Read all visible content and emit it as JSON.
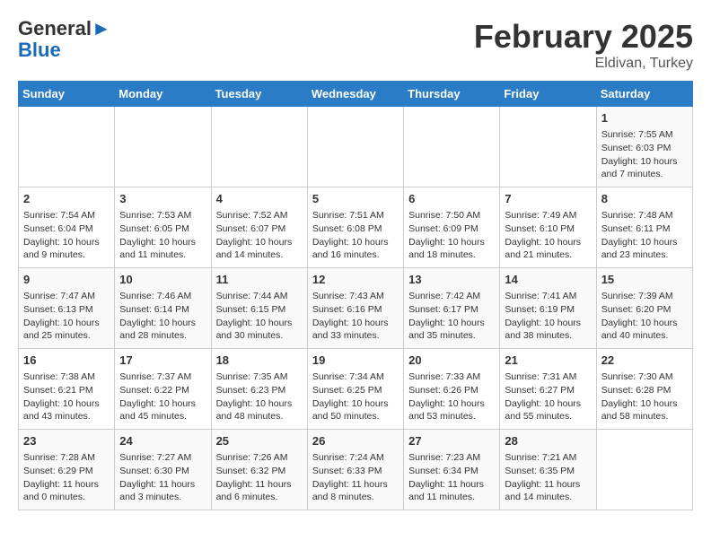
{
  "header": {
    "logo_line1": "General",
    "logo_line2": "Blue",
    "main_title": "February 2025",
    "subtitle": "Eldivan, Turkey"
  },
  "days_of_week": [
    "Sunday",
    "Monday",
    "Tuesday",
    "Wednesday",
    "Thursday",
    "Friday",
    "Saturday"
  ],
  "weeks": [
    [
      {
        "num": "",
        "info": ""
      },
      {
        "num": "",
        "info": ""
      },
      {
        "num": "",
        "info": ""
      },
      {
        "num": "",
        "info": ""
      },
      {
        "num": "",
        "info": ""
      },
      {
        "num": "",
        "info": ""
      },
      {
        "num": "1",
        "info": "Sunrise: 7:55 AM\nSunset: 6:03 PM\nDaylight: 10 hours and 7 minutes."
      }
    ],
    [
      {
        "num": "2",
        "info": "Sunrise: 7:54 AM\nSunset: 6:04 PM\nDaylight: 10 hours and 9 minutes."
      },
      {
        "num": "3",
        "info": "Sunrise: 7:53 AM\nSunset: 6:05 PM\nDaylight: 10 hours and 11 minutes."
      },
      {
        "num": "4",
        "info": "Sunrise: 7:52 AM\nSunset: 6:07 PM\nDaylight: 10 hours and 14 minutes."
      },
      {
        "num": "5",
        "info": "Sunrise: 7:51 AM\nSunset: 6:08 PM\nDaylight: 10 hours and 16 minutes."
      },
      {
        "num": "6",
        "info": "Sunrise: 7:50 AM\nSunset: 6:09 PM\nDaylight: 10 hours and 18 minutes."
      },
      {
        "num": "7",
        "info": "Sunrise: 7:49 AM\nSunset: 6:10 PM\nDaylight: 10 hours and 21 minutes."
      },
      {
        "num": "8",
        "info": "Sunrise: 7:48 AM\nSunset: 6:11 PM\nDaylight: 10 hours and 23 minutes."
      }
    ],
    [
      {
        "num": "9",
        "info": "Sunrise: 7:47 AM\nSunset: 6:13 PM\nDaylight: 10 hours and 25 minutes."
      },
      {
        "num": "10",
        "info": "Sunrise: 7:46 AM\nSunset: 6:14 PM\nDaylight: 10 hours and 28 minutes."
      },
      {
        "num": "11",
        "info": "Sunrise: 7:44 AM\nSunset: 6:15 PM\nDaylight: 10 hours and 30 minutes."
      },
      {
        "num": "12",
        "info": "Sunrise: 7:43 AM\nSunset: 6:16 PM\nDaylight: 10 hours and 33 minutes."
      },
      {
        "num": "13",
        "info": "Sunrise: 7:42 AM\nSunset: 6:17 PM\nDaylight: 10 hours and 35 minutes."
      },
      {
        "num": "14",
        "info": "Sunrise: 7:41 AM\nSunset: 6:19 PM\nDaylight: 10 hours and 38 minutes."
      },
      {
        "num": "15",
        "info": "Sunrise: 7:39 AM\nSunset: 6:20 PM\nDaylight: 10 hours and 40 minutes."
      }
    ],
    [
      {
        "num": "16",
        "info": "Sunrise: 7:38 AM\nSunset: 6:21 PM\nDaylight: 10 hours and 43 minutes."
      },
      {
        "num": "17",
        "info": "Sunrise: 7:37 AM\nSunset: 6:22 PM\nDaylight: 10 hours and 45 minutes."
      },
      {
        "num": "18",
        "info": "Sunrise: 7:35 AM\nSunset: 6:23 PM\nDaylight: 10 hours and 48 minutes."
      },
      {
        "num": "19",
        "info": "Sunrise: 7:34 AM\nSunset: 6:25 PM\nDaylight: 10 hours and 50 minutes."
      },
      {
        "num": "20",
        "info": "Sunrise: 7:33 AM\nSunset: 6:26 PM\nDaylight: 10 hours and 53 minutes."
      },
      {
        "num": "21",
        "info": "Sunrise: 7:31 AM\nSunset: 6:27 PM\nDaylight: 10 hours and 55 minutes."
      },
      {
        "num": "22",
        "info": "Sunrise: 7:30 AM\nSunset: 6:28 PM\nDaylight: 10 hours and 58 minutes."
      }
    ],
    [
      {
        "num": "23",
        "info": "Sunrise: 7:28 AM\nSunset: 6:29 PM\nDaylight: 11 hours and 0 minutes."
      },
      {
        "num": "24",
        "info": "Sunrise: 7:27 AM\nSunset: 6:30 PM\nDaylight: 11 hours and 3 minutes."
      },
      {
        "num": "25",
        "info": "Sunrise: 7:26 AM\nSunset: 6:32 PM\nDaylight: 11 hours and 6 minutes."
      },
      {
        "num": "26",
        "info": "Sunrise: 7:24 AM\nSunset: 6:33 PM\nDaylight: 11 hours and 8 minutes."
      },
      {
        "num": "27",
        "info": "Sunrise: 7:23 AM\nSunset: 6:34 PM\nDaylight: 11 hours and 11 minutes."
      },
      {
        "num": "28",
        "info": "Sunrise: 7:21 AM\nSunset: 6:35 PM\nDaylight: 11 hours and 14 minutes."
      },
      {
        "num": "",
        "info": ""
      }
    ]
  ]
}
